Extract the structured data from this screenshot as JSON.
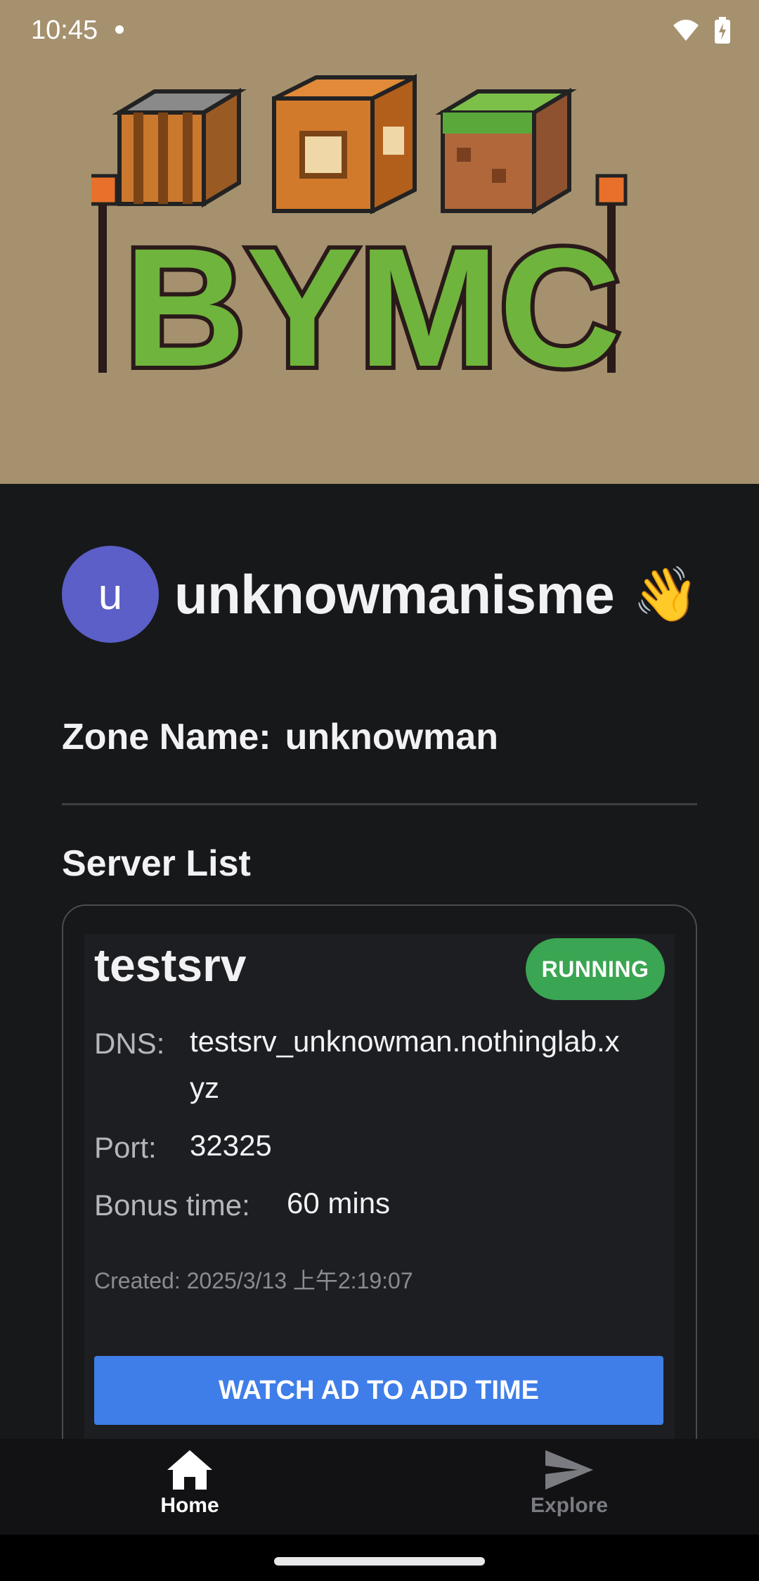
{
  "status_bar": {
    "time": "10:45"
  },
  "banner": {
    "logo_text": "BYMC"
  },
  "user": {
    "avatar_letter": "u",
    "username": "unknowmanisme",
    "wave_emoji": "👋"
  },
  "zone": {
    "label": "Zone Name:",
    "value": "unknowman"
  },
  "server_list": {
    "title": "Server List",
    "servers": [
      {
        "name": "testsrv",
        "status": "RUNNING",
        "dns_label": "DNS:",
        "dns_value_line1": "testsrv_unknowman.nothinglab.x",
        "dns_value_line2": "yz",
        "port_label": "Port:",
        "port_value": "32325",
        "bonus_label": "Bonus time:",
        "bonus_value": "60 mins",
        "created": "Created: 2025/3/13 上午2:19:07",
        "button_label": "WATCH AD TO ADD TIME"
      }
    ]
  },
  "bottom_nav": {
    "items": [
      {
        "label": "Home",
        "icon": "home-icon",
        "active": true
      },
      {
        "label": "Explore",
        "icon": "send-icon",
        "active": false
      }
    ]
  },
  "colors": {
    "accent": "#3f7ee8",
    "running": "#3aa552",
    "avatar": "#5b5fc7",
    "banner_bg": "#a6916f",
    "background": "#17181a"
  }
}
